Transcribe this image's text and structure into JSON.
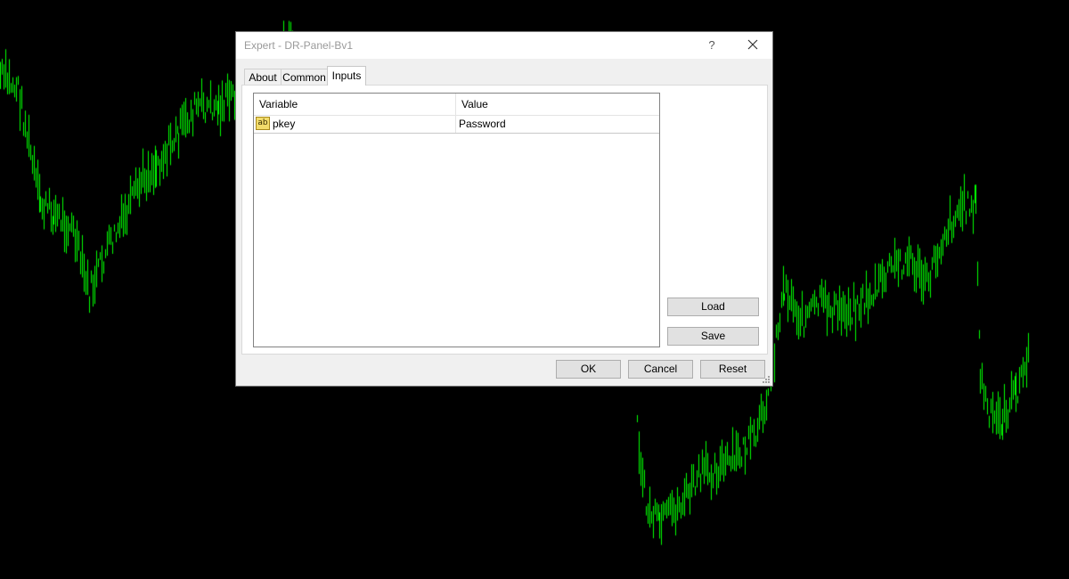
{
  "window": {
    "title": "Expert - DR-Panel-Bv1",
    "help_label": "?",
    "close_icon": "close-icon"
  },
  "tabs": [
    {
      "label": "About",
      "active": false
    },
    {
      "label": "Common",
      "active": false
    },
    {
      "label": "Inputs",
      "active": true
    }
  ],
  "inputs_table": {
    "headers": [
      "Variable",
      "Value"
    ],
    "rows": [
      {
        "type_icon": "string-type-icon",
        "type_icon_text": "ab",
        "variable": "pkey",
        "value": "Password"
      }
    ]
  },
  "side_buttons": {
    "load_label": "Load",
    "save_label": "Save"
  },
  "footer_buttons": {
    "ok_label": "OK",
    "cancel_label": "Cancel",
    "reset_label": "Reset"
  },
  "background_chart": {
    "bar_color": "#00ff00",
    "background_color": "#000000"
  }
}
